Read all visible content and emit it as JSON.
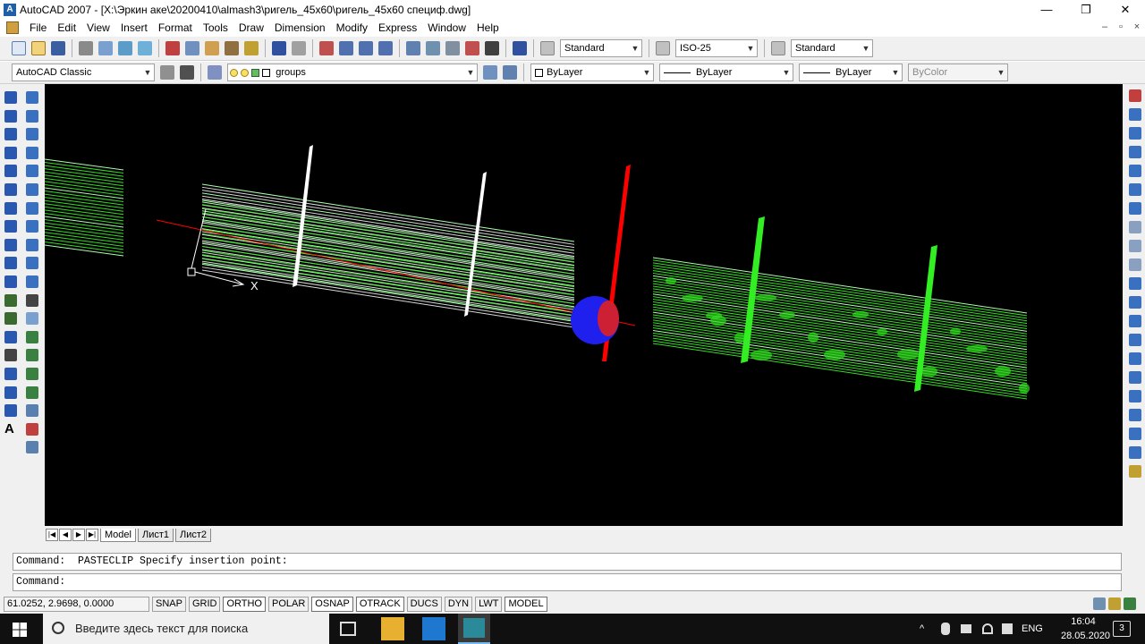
{
  "window": {
    "app_icon": "A",
    "title": "AutoCAD 2007 - [X:\\Эркин аке\\20200410\\almash3\\ригель_45х60\\ригель_45х60 специф.dwg]",
    "minimize_glyph": "—",
    "restore_glyph": "❐",
    "close_glyph": "✕"
  },
  "menubar": {
    "items": [
      "File",
      "Edit",
      "View",
      "Insert",
      "Format",
      "Tools",
      "Draw",
      "Dimension",
      "Modify",
      "Express",
      "Window",
      "Help"
    ],
    "doc_controls": [
      "–",
      "▫",
      "×"
    ]
  },
  "toolbar1": {
    "text_style": "Standard",
    "dim_style": "ISO-25",
    "table_style": "Standard"
  },
  "toolbar2": {
    "workspace": "AutoCAD Classic",
    "layer": "groups",
    "color": "ByLayer",
    "linetype": "ByLayer",
    "lineweight": "ByLayer",
    "plotstyle": "ByColor"
  },
  "left_toolbar_icon_letter": "A",
  "canvas": {
    "ucs_x_label": "X"
  },
  "layout_tabs": {
    "nav": [
      "|◀",
      "◀",
      "▶",
      "▶|"
    ],
    "tabs": [
      "Model",
      "Лист1",
      "Лист2"
    ]
  },
  "command": {
    "history": "Command:  PASTECLIP Specify insertion point:",
    "prompt": "Command:"
  },
  "statusbar": {
    "coordinates": "61.0252, 2.9698, 0.0000",
    "toggles": [
      {
        "label": "SNAP",
        "on": false
      },
      {
        "label": "GRID",
        "on": false
      },
      {
        "label": "ORTHO",
        "on": true
      },
      {
        "label": "POLAR",
        "on": false
      },
      {
        "label": "OSNAP",
        "on": true
      },
      {
        "label": "OTRACK",
        "on": true
      },
      {
        "label": "DUCS",
        "on": false
      },
      {
        "label": "DYN",
        "on": false
      },
      {
        "label": "LWT",
        "on": false
      },
      {
        "label": "MODEL",
        "on": true
      }
    ]
  },
  "taskbar": {
    "search_placeholder": "Введите здесь текст для поиска",
    "language": "ENG",
    "time": "16:04",
    "date": "28.05.2020",
    "notification_count": "3"
  },
  "colors": {
    "canvas_bg": "#000000",
    "geometry_green": "#33dd22",
    "axis_red": "#ff0000",
    "ucs_blue": "#2222ff"
  }
}
